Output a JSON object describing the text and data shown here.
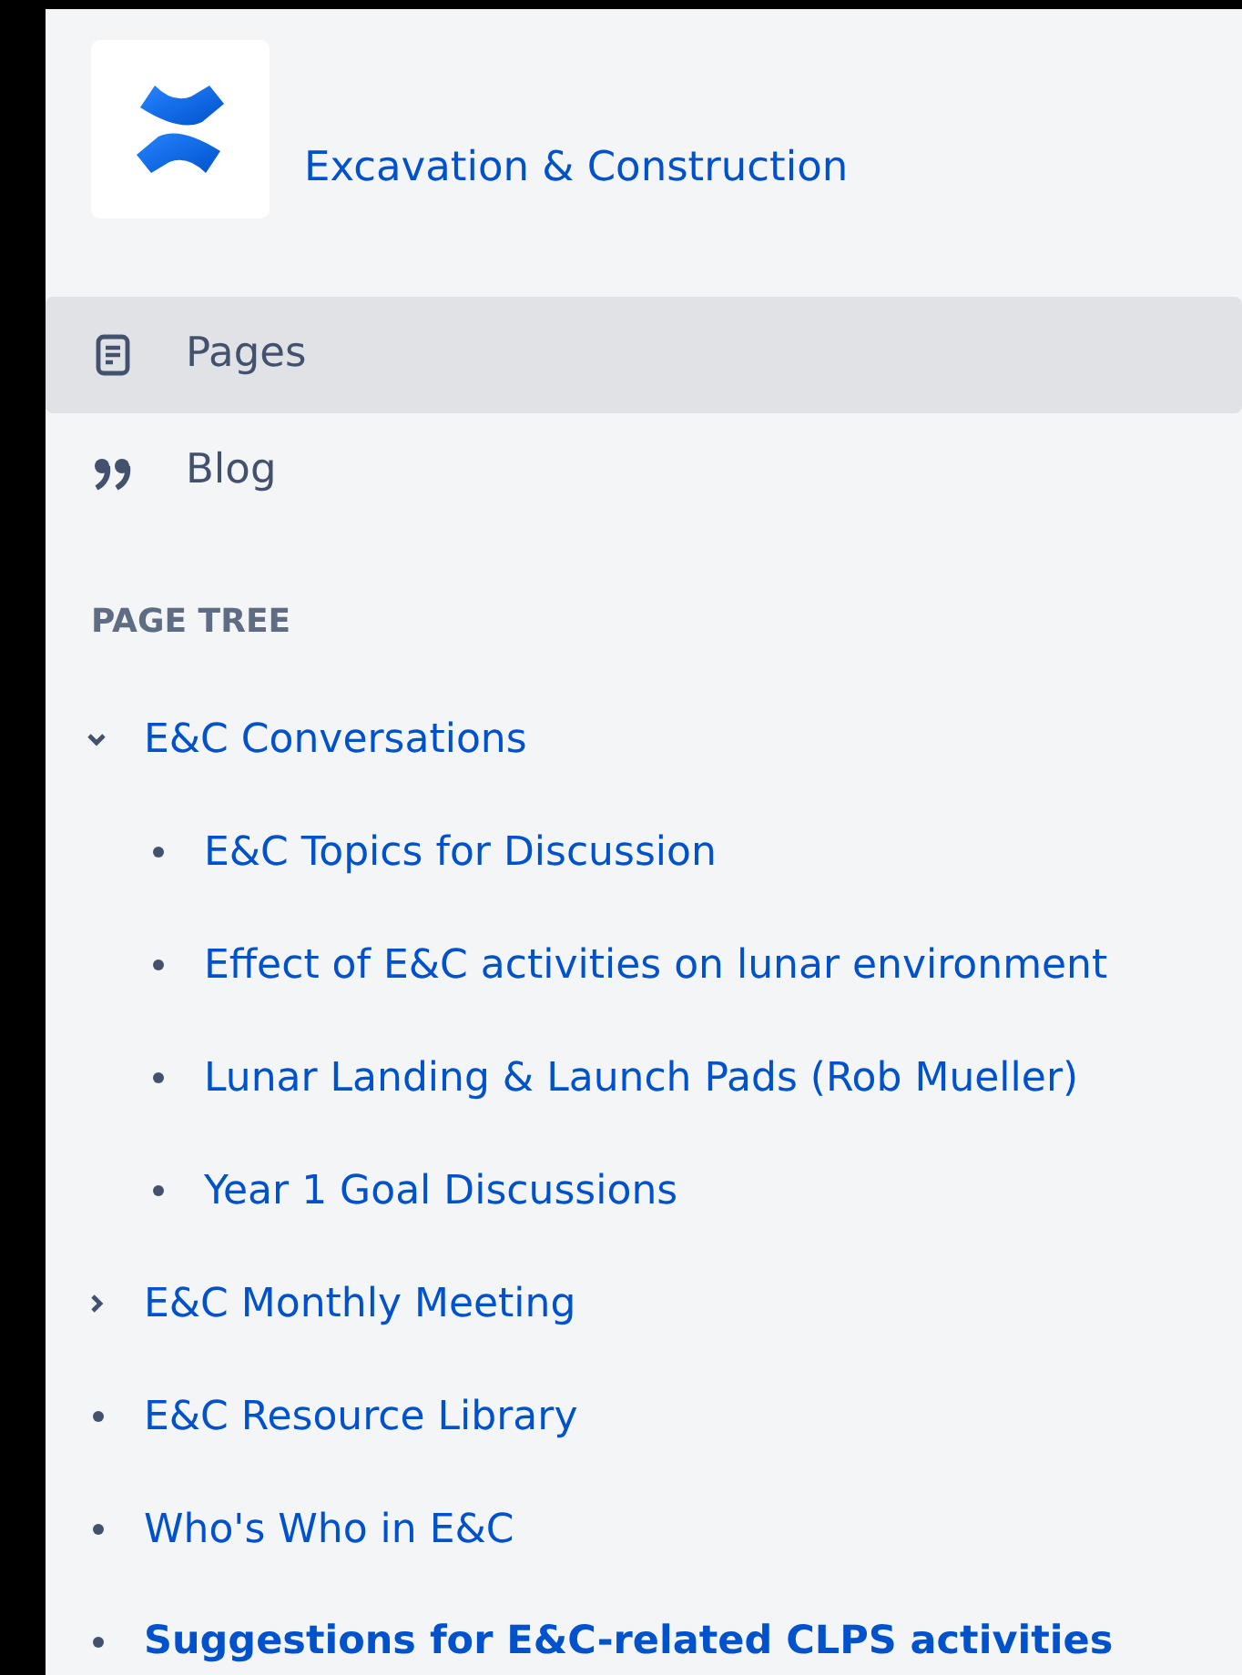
{
  "space": {
    "title": "Excavation & Construction"
  },
  "nav": [
    {
      "label": "Pages",
      "kind": "page",
      "selected": true
    },
    {
      "label": "Blog",
      "kind": "quote",
      "selected": false
    }
  ],
  "page_tree": {
    "heading": "PAGE TREE",
    "items": [
      {
        "label": "E&C Conversations",
        "kind": "parent",
        "expanded": true,
        "selected": false,
        "children": [
          {
            "label": "E&C Topics for Discussion",
            "kind": "leaf",
            "selected": false
          },
          {
            "label": "Effect of E&C activities on lunar environment",
            "kind": "leaf",
            "selected": false
          },
          {
            "label": "Lunar Landing & Launch Pads (Rob Mueller)",
            "kind": "leaf",
            "selected": false
          },
          {
            "label": "Year 1 Goal Discussions",
            "kind": "leaf",
            "selected": false
          }
        ]
      },
      {
        "label": "E&C Monthly Meeting",
        "kind": "parent",
        "expanded": false,
        "selected": false
      },
      {
        "label": "E&C Resource Library",
        "kind": "leaf",
        "selected": false
      },
      {
        "label": "Who's Who in E&C",
        "kind": "leaf",
        "selected": false
      },
      {
        "label": "Suggestions for E&C-related CLPS activities",
        "kind": "leaf",
        "selected": true
      }
    ]
  }
}
